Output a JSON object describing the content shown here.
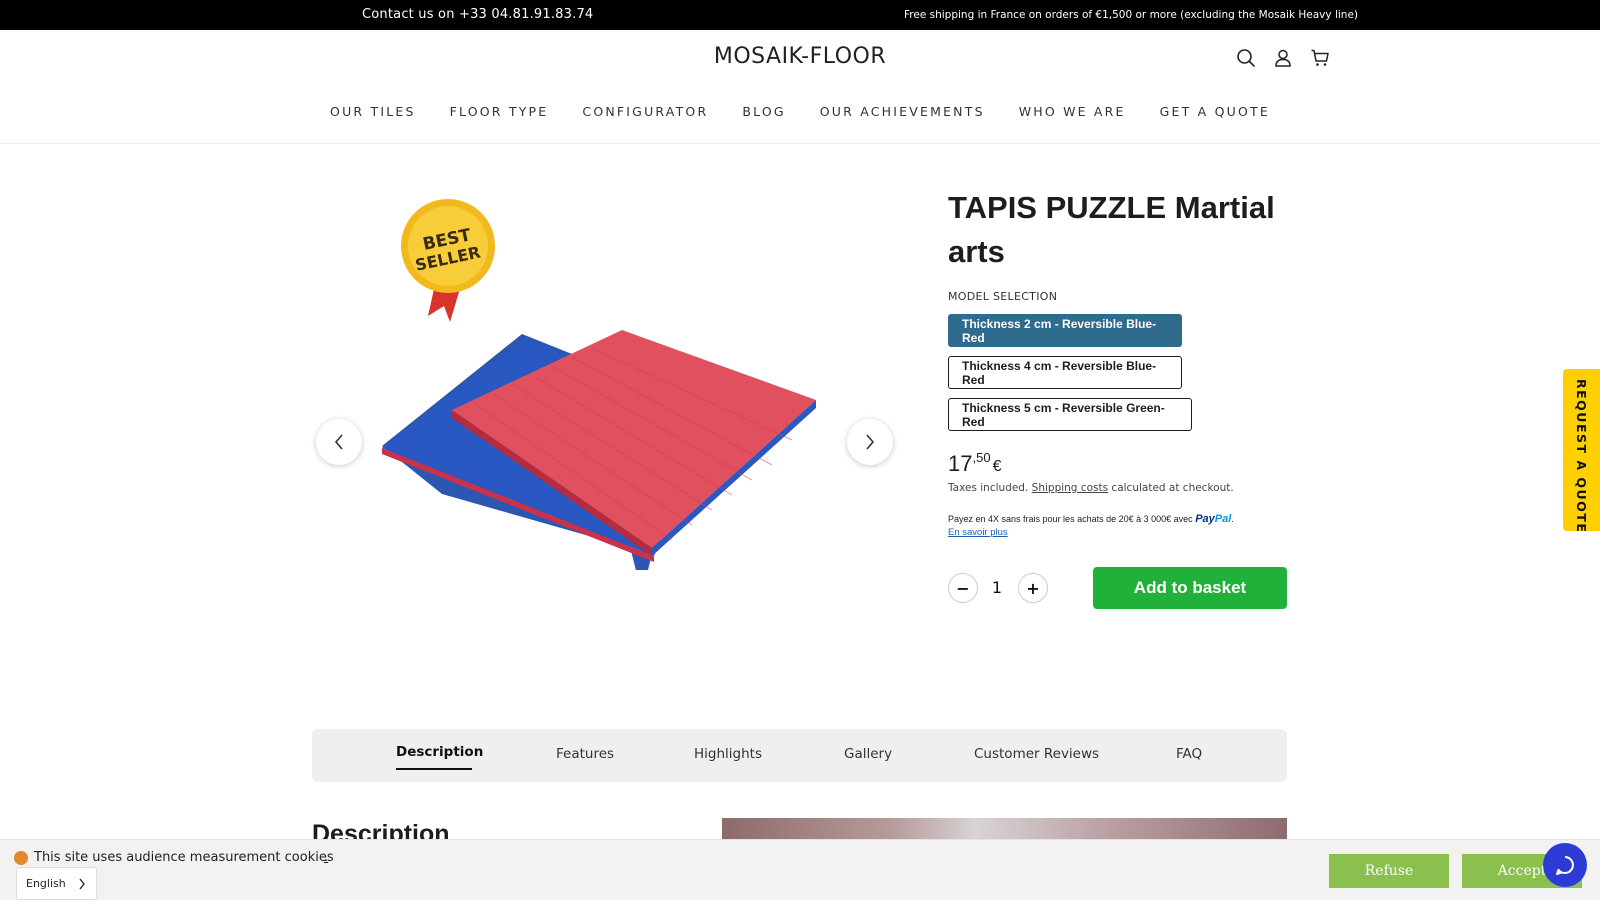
{
  "topbar": {
    "contact": "Contact us on +33 04.81.91.83.74",
    "shipping": "Free shipping in France on orders of €1,500 or more (excluding the Mosaik Heavy line)"
  },
  "header": {
    "logo": "MOSAIK-FLOOR",
    "icons": [
      "search-icon",
      "account-icon",
      "cart-icon"
    ]
  },
  "nav": {
    "items": [
      "OUR TILES",
      "FLOOR TYPE",
      "CONFIGURATOR",
      "BLOG",
      "OUR ACHIEVEMENTS",
      "WHO WE ARE",
      "GET A QUOTE"
    ]
  },
  "gallery": {
    "badge_line1": "BEST",
    "badge_line2": "SELLER"
  },
  "product": {
    "title": "TAPIS PUZZLE Martial arts",
    "model_label": "MODEL SELECTION",
    "variants": [
      "Thickness 2 cm - Reversible Blue-Red",
      "Thickness 4 cm - Reversible Blue-Red",
      "Thickness 5 cm - Reversible Green-Red"
    ],
    "selected_variant": 0,
    "price_int": "17",
    "price_cents": ",50",
    "currency": "€",
    "tax_prefix": "Taxes included.",
    "shipping_link": "Shipping costs",
    "tax_suffix": "calculated at checkout.",
    "paypal_text": "Payez en 4X sans frais pour les achats de 20€ à 3 000€ avec",
    "paypal_pay": "Pay",
    "paypal_pal": "Pal",
    "learn_more": "En savoir plus",
    "quantity": "1",
    "minus": "−",
    "plus": "+",
    "add_to_basket": "Add to basket",
    "accent_color": "#2f6b8c",
    "button_color": "#21b13a"
  },
  "side_tab": {
    "label": "REQUEST A QUOTE",
    "color": "#ffd000"
  },
  "tabs": {
    "items": [
      "Description",
      "Features",
      "Highlights",
      "Gallery",
      "Customer Reviews",
      "FAQ"
    ],
    "active": 0
  },
  "description": {
    "heading": "Description"
  },
  "cookie": {
    "text": "This site uses audience measurement cookies",
    "more": ".",
    "refuse": "Refuse",
    "accept": "Accept",
    "button_color": "#8bc04e"
  },
  "language": {
    "selected": "English"
  }
}
